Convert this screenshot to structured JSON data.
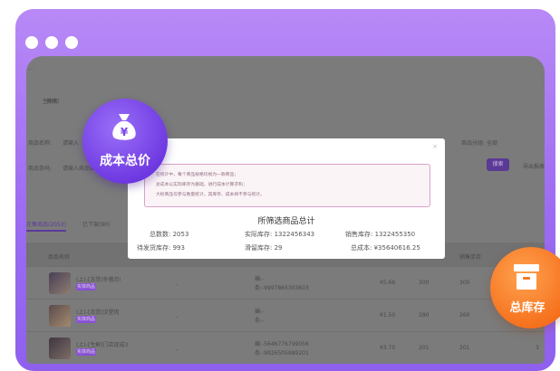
{
  "app": {
    "breadcrumb": [
      "...",
      "生鲜和"
    ],
    "filters": {
      "name_label": "商品名称:",
      "name_value": "请输入",
      "code_label": "商品条码:",
      "code_placeholder": "请输入商品条码",
      "category_label": "商品分组:",
      "category_value": "全部"
    },
    "buttons": {
      "search": "搜索",
      "export": "导出报表"
    },
    "tabs": [
      {
        "label": "在售商品(2053)",
        "active": true
      },
      {
        "label": "已下架(90)",
        "active": false
      }
    ],
    "table_headers": {
      "name": "商品名称",
      "sale_stock": "销售库存"
    },
    "rows": [
      {
        "title": "(上)-[冻货]冬蓉月!",
        "tag": "实体商品",
        "dash": "-",
        "field_a": "编:-",
        "field_b": "条:-9997865303603",
        "price": "¥5.66",
        "actual": "300",
        "sale": "300",
        "extra": ""
      },
      {
        "title": "(上)-[冻货]汉堡肉",
        "tag": "实体商品",
        "dash": "-",
        "field_a": "编:-",
        "field_b": "条:-",
        "price": "¥1.50",
        "actual": "280",
        "sale": "260",
        "extra": ""
      },
      {
        "title": "(上)-[生鲜]门店现成3",
        "tag": "实体商品",
        "dash": "-",
        "field_a": "编:-5646776799056",
        "field_b": "条:-9926505989201",
        "price": "¥3.70",
        "actual": "201",
        "sale": "201",
        "extra": "3"
      }
    ]
  },
  "modal": {
    "notice": [
      "在统计中，每个商品规格均视为一款商品；",
      "总成本以实际库存为基础，进行成本计算求和；",
      "大标商品仅参与数量统计，其库存、成本将不参与统计。"
    ],
    "title": "所筛选商品总计",
    "stats": [
      {
        "label": "总数数:",
        "value": "2053"
      },
      {
        "label": "实际库存:",
        "value": "1322456343"
      },
      {
        "label": "销售库存:",
        "value": "1322455350"
      },
      {
        "label": "待发货库存:",
        "value": "993"
      },
      {
        "label": "滑留库存:",
        "value": "29"
      },
      {
        "label": "总成本:",
        "value": "¥35640616.25"
      }
    ],
    "close": "×"
  },
  "badges": {
    "left_label": "成本总价",
    "left_symbol": "¥",
    "right_label": "总库存"
  },
  "colors": {
    "frame": "#9d6cf2",
    "left_badge": "#6c36e0",
    "right_badge": "#f56e1a",
    "tag": "#8a4fd6",
    "notice_border": "#d8a2c8"
  }
}
